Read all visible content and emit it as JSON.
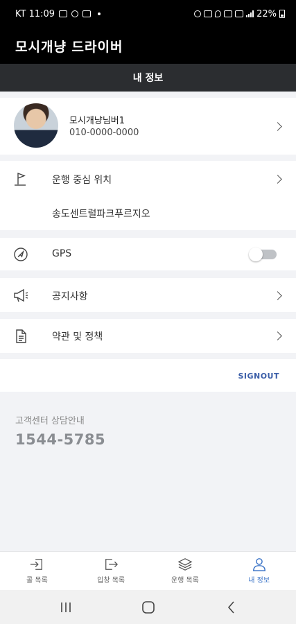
{
  "status_bar": {
    "carrier_time": "KT 11:09",
    "battery": "22%"
  },
  "app": {
    "title": "모시개냥 드라이버",
    "section_title": "내 정보"
  },
  "profile": {
    "name": "모시개냥님버1",
    "phone": "010-0000-0000"
  },
  "operation_center": {
    "label": "운행 중심 위치",
    "value": "송도센트럴파크푸르지오"
  },
  "gps": {
    "label": "GPS",
    "enabled": false
  },
  "menu": {
    "notice": "공지사항",
    "terms": "약관 및 정책"
  },
  "signout_label": "SIGNOUT",
  "customer_center": {
    "label": "고객센터 상담안내",
    "phone": "1544-5785"
  },
  "tabs": [
    {
      "label": "콜 목록",
      "icon": "login-icon"
    },
    {
      "label": "입창 목록",
      "icon": "logout-icon"
    },
    {
      "label": "운행 목록",
      "icon": "layers-icon"
    },
    {
      "label": "내 정보",
      "icon": "user-icon",
      "active": true
    }
  ],
  "colors": {
    "accent": "#3b74c7",
    "signout": "#3b5ea8",
    "header_bg": "#000000",
    "subheader_bg": "#2b2d30"
  }
}
